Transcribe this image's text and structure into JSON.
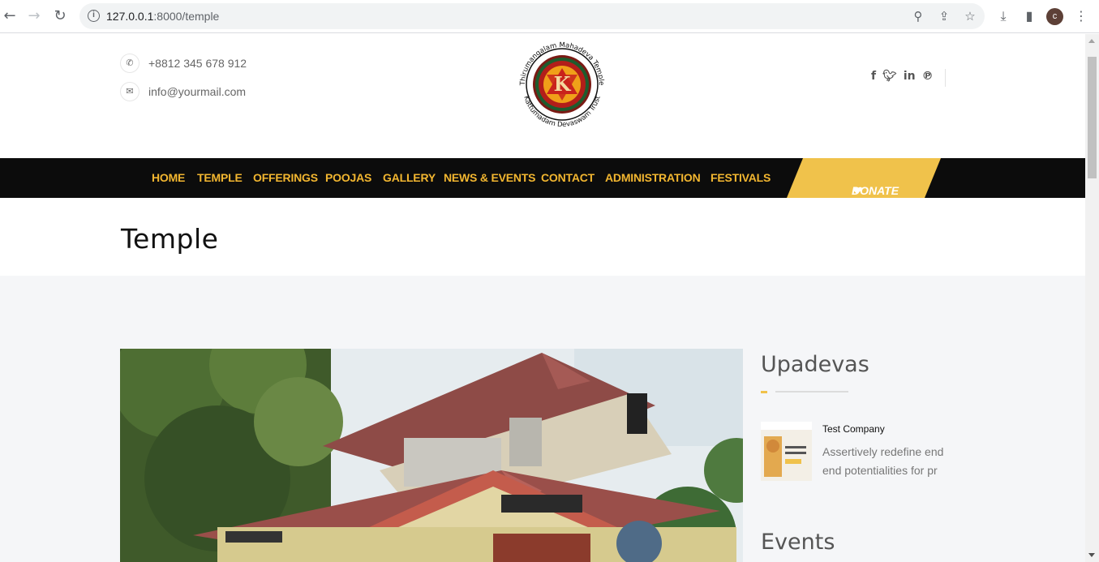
{
  "browser": {
    "url_host": "127.0.0.1",
    "url_rest": ":8000/temple",
    "profile_initial": "c"
  },
  "header": {
    "phone": "+8812 345 678 912",
    "email": "info@yourmail.com",
    "logo_text_top": "Thirumangalam Mahadeva Temple",
    "logo_text_bottom": "Kattumadam Devaswam Trust",
    "logo_letter": "K"
  },
  "social": [
    "facebook-icon",
    "twitter-icon",
    "linkedin-icon",
    "pinterest-icon"
  ],
  "nav": {
    "items": [
      "HOME",
      "TEMPLE",
      "OFFERINGS",
      "POOJAS",
      "GALLERY",
      "NEWS & EVENTS",
      "CONTACT",
      "ADMINISTRATION",
      "FESTIVALS"
    ],
    "donate_label": "DONATE NOW"
  },
  "page": {
    "title": "Temple"
  },
  "sidebar": {
    "upadevas_title": "Upadevas",
    "upadeva_item": {
      "name": "Test Company",
      "description": "Assertively redefine end end potentialities for pr"
    },
    "events_title": "Events"
  },
  "colors": {
    "accent": "#f0c24b",
    "nav_text": "#f2b630",
    "nav_bg": "#0c0c0c",
    "content_bg": "#f5f6f8"
  }
}
